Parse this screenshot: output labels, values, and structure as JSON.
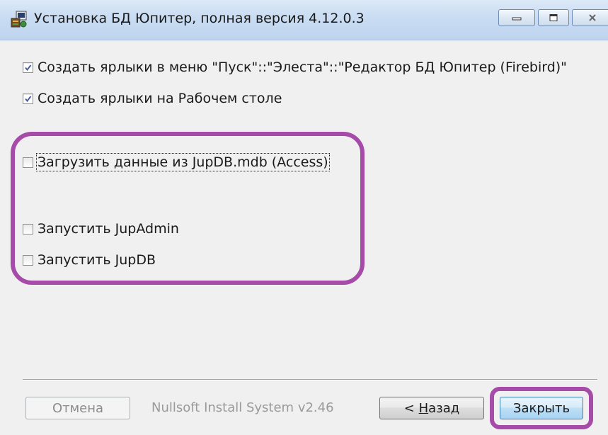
{
  "window": {
    "title": "Установка БД Юпитер, полная версия 4.12.0.3"
  },
  "options": [
    {
      "label": "Создать ярлыки в меню \"Пуск\"::\"Элеста\"::\"Редактор БД Юпитер (Firebird)\"",
      "checked": true
    },
    {
      "label": "Создать ярлыки на Рабочем столе",
      "checked": true
    },
    {
      "label": "Загрузить данные из JupDB.mdb (Access)",
      "checked": false
    },
    {
      "label": "Запустить JupAdmin",
      "checked": false
    },
    {
      "label": "Запустить JupDB",
      "checked": false
    }
  ],
  "footer": {
    "cancel_label": "Отмена",
    "branding": "Nullsoft Install System v2.46",
    "back_arrow": "< ",
    "back_mnemonic": "Н",
    "back_rest": "азад",
    "close_label": "Закрыть"
  },
  "colors": {
    "highlight": "#a64ba7",
    "checkmark": "#4a5fa0"
  },
  "icons": {
    "app": "installer-icon",
    "minimize": "minimize-icon",
    "maximize": "maximize-icon",
    "close": "close-icon",
    "check": "check-icon"
  }
}
